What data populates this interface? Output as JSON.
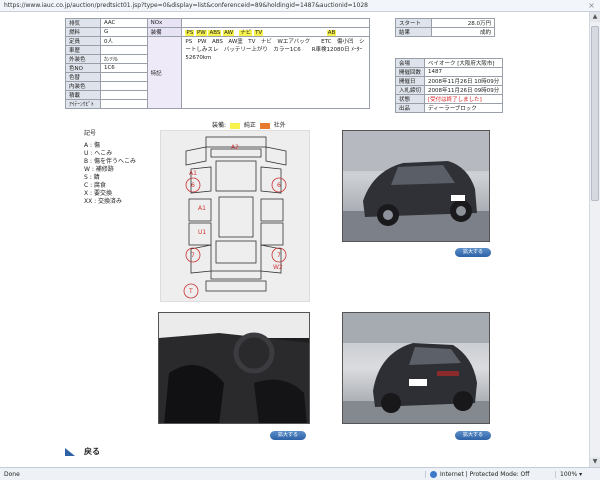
{
  "browser": {
    "url": "https://www.iauc.co.jp/auction/predtsict01.jsp?type=0&display=list&conferenceid=89&holdingid=1487&auctionid=1028",
    "status_done": "Done",
    "zone_text": "Internet | Protected Mode: Off",
    "zoom_text": "100%"
  },
  "spec": {
    "rows": [
      {
        "label": "排気",
        "value": "AAC"
      },
      {
        "label": "燃料",
        "value": "G"
      },
      {
        "label": "定員",
        "value": "0人"
      },
      {
        "label": "車歴",
        "value": ""
      },
      {
        "label": "外装色",
        "value": "ｶﾝｿﾘﾙ"
      },
      {
        "label": "色NO",
        "value": "1C6"
      },
      {
        "label": "色替",
        "value": ""
      },
      {
        "label": "内装色",
        "value": ""
      },
      {
        "label": "積載",
        "value": ""
      },
      {
        "label": "ｱｲﾃｰﾝｳﾋﾟﾄ",
        "value": ""
      }
    ],
    "nox_label": "NOx",
    "equip_label": "装備",
    "equip_tags": [
      "PS",
      "PW",
      "ABS",
      "AW",
      "ナビ",
      "TV"
    ],
    "equip_ab": "AB",
    "tokki_label": "特記",
    "tokki_text": "PS　PW　ABS　AW塗　TV　ナビ　Wエアバック　　ETC　傷小凹　シートしみスレ　バッテリー上がり　カラー1C6　　R車検12080日 ﾒｰﾀｰ 52670km"
  },
  "auction": {
    "start_label": "スタート",
    "start_value": "28.0万円",
    "result_label": "結果",
    "result_value": "成約",
    "rows": [
      {
        "label": "会場",
        "value": "ベイオーク [大阪府大阪市]"
      },
      {
        "label": "開催回数",
        "value": "1487"
      },
      {
        "label": "開催日",
        "value": "2008年11月26日 10時09分"
      },
      {
        "label": "入札締切",
        "value": "2008年11月26日 09時09分"
      },
      {
        "label": "状態",
        "value": "[受付は終了しました]"
      },
      {
        "label": "出品",
        "value": "ディーラーブロック"
      }
    ]
  },
  "legend": {
    "title": "装備:",
    "pure": "純正",
    "aftermarket": "社外"
  },
  "marks": {
    "title": "記号",
    "items": [
      "A : 傷",
      "U : へこみ",
      "B : 傷を伴うへこみ",
      "W : 補修跡",
      "S : 錆",
      "C : 腐食",
      "X : 要交換",
      "XX : 交換済み"
    ]
  },
  "diagram_marks": [
    "A2",
    "A1",
    "A1",
    "U1",
    "W2",
    "6",
    "6",
    "7",
    "7",
    "T"
  ],
  "buttons": {
    "enlarge": "拡大する"
  },
  "back": {
    "label": "戻る"
  },
  "colors": {
    "pure": "#f8f24c",
    "aftermarket": "#e87a2e",
    "header_blue": "#2f62a6"
  }
}
